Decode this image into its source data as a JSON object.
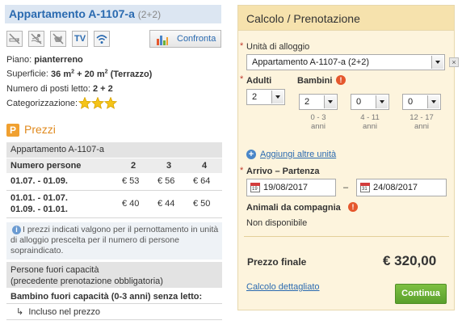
{
  "unit": {
    "title": "Appartamento A-1107-a",
    "capacity": "(2+2)",
    "amenities": [
      "no-smoking-icon",
      "no-swimming-icon",
      "no-pets-icon",
      "tv-icon",
      "wifi-icon"
    ],
    "tv_label": "TV",
    "compare_label": "Confronta",
    "floor_label": "Piano:",
    "floor_value": "pianterreno",
    "area_label": "Superficie:",
    "area_value_a": "36 m",
    "area_sup_a": "2",
    "area_value_b": " + 20 m",
    "area_sup_b": "2",
    "area_value_c": " (Terrazzo)",
    "beds_label": "Numero di posti letto:",
    "beds_value": "2 + 2",
    "category_label": "Categorizzazione:",
    "stars": 3
  },
  "prices": {
    "section_icon": "P",
    "section_title": "Prezzi",
    "table_title": "Appartamento A-1107-a",
    "persons_header": "Numero persone",
    "columns": [
      "2",
      "3",
      "4"
    ],
    "rows": [
      {
        "period": [
          "01.07. - 01.09."
        ],
        "values": [
          "€ 53",
          "€ 56",
          "€ 64"
        ]
      },
      {
        "period": [
          "01.01. - 01.07.",
          "01.09. - 01.01."
        ],
        "values": [
          "€ 40",
          "€ 44",
          "€ 50"
        ]
      }
    ],
    "note": "I prezzi indicati valgono per il pernottamento in unità di alloggio prescelta per il numero di persone sopraindicato.",
    "extra_title": "Persone fuori capacità",
    "extra_subtitle": "(precedente prenotazione obbligatoria)",
    "child_label": "Bambino fuori capacità (0-3 anni) senza letto:",
    "child_value": "Incluso nel prezzo"
  },
  "booking": {
    "title": "Calcolo / Prenotazione",
    "unit_label": "Unità di alloggio",
    "unit_selected": "Appartamento A-1107-a (2+2)",
    "adults_label": "Adulti",
    "adults_value": "2",
    "children_label": "Bambini",
    "children": [
      {
        "value": "2",
        "age": "0 - 3",
        "unit": "anni"
      },
      {
        "value": "0",
        "age": "4 - 11",
        "unit": "anni"
      },
      {
        "value": "0",
        "age": "12 - 17",
        "unit": "anni"
      }
    ],
    "add_units": "Aggiungi altre unità",
    "dates_label": "Arrivo – Partenza",
    "arrival": "19/08/2017",
    "departure": "24/08/2017",
    "cal_start": "19",
    "cal_end": "31",
    "date_dash": "–",
    "pets_label": "Animali da compagnia",
    "pets_value": "Non disponibile",
    "final_label": "Prezzo finale",
    "final_value": "€ 320,00",
    "details_link": "Calcolo dettagliato",
    "continue_label": "Continua",
    "required_mark": "*",
    "warn_mark": "!"
  },
  "colors": {
    "accent_blue": "#2a6ab0",
    "orange": "#e08a1e",
    "panel_bg": "#fdf4dd",
    "continue_green": "#6cb038"
  }
}
